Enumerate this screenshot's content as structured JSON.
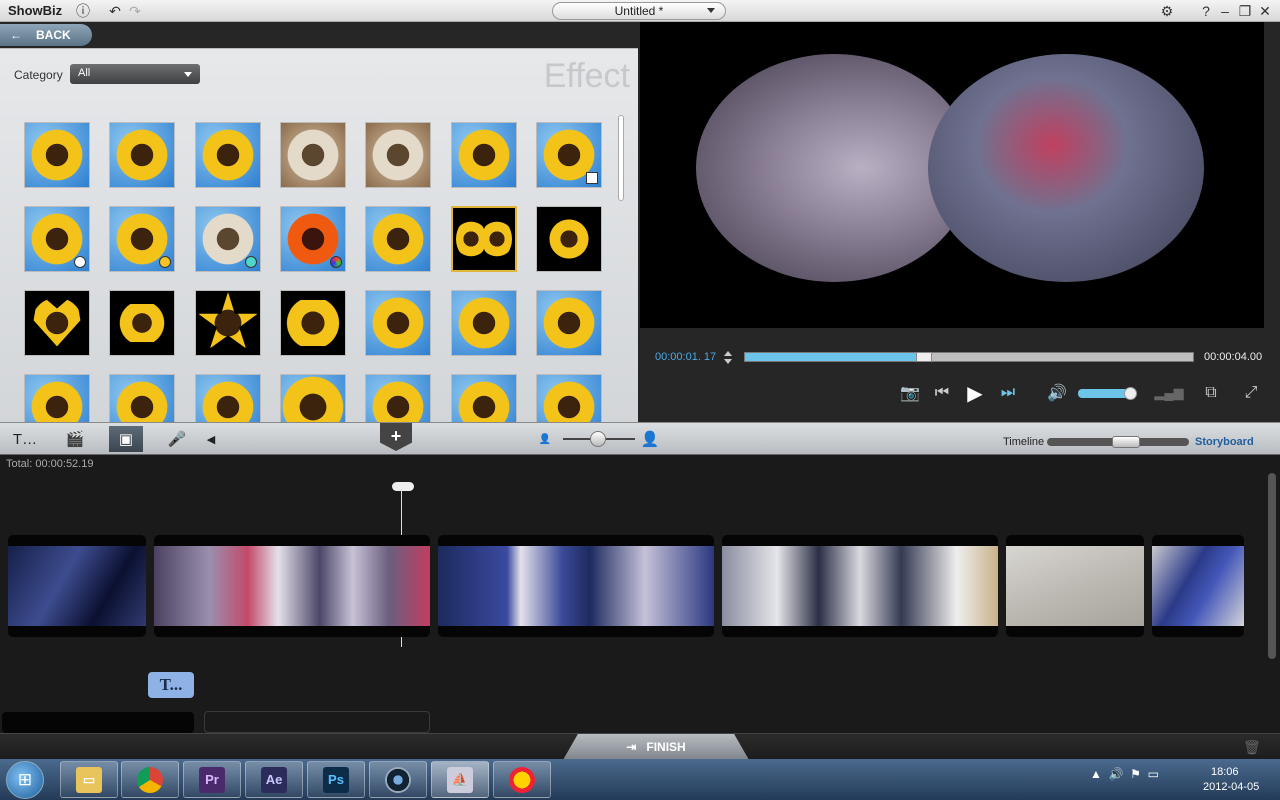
{
  "app": {
    "name": "ShowBiz",
    "project_title": "Untitled *"
  },
  "library": {
    "back_label": "BACK",
    "category_label": "Category",
    "category_value": "All",
    "panel_title": "Effect"
  },
  "preview": {
    "current_time": "00:00:01. 17",
    "total_time": "00:00:04.00",
    "progress": 0.4,
    "volume": 0.85
  },
  "toolbar": {
    "timeline_label": "Timeline",
    "storyboard_label": "Storyboard"
  },
  "storyboard": {
    "total_label": "Total:",
    "total_time": "00:00:52.19",
    "title_track_label": "T..."
  },
  "footer": {
    "finish_label": "FINISH"
  },
  "taskbar": {
    "apps": [
      "Pr",
      "Ae",
      "Ps"
    ],
    "time": "18:06",
    "date": "2012-04-05"
  },
  "colors": {
    "accent": "#4ca9e6",
    "selection": "#e1b53a",
    "storyboard_blue": "#1f5e9c"
  }
}
